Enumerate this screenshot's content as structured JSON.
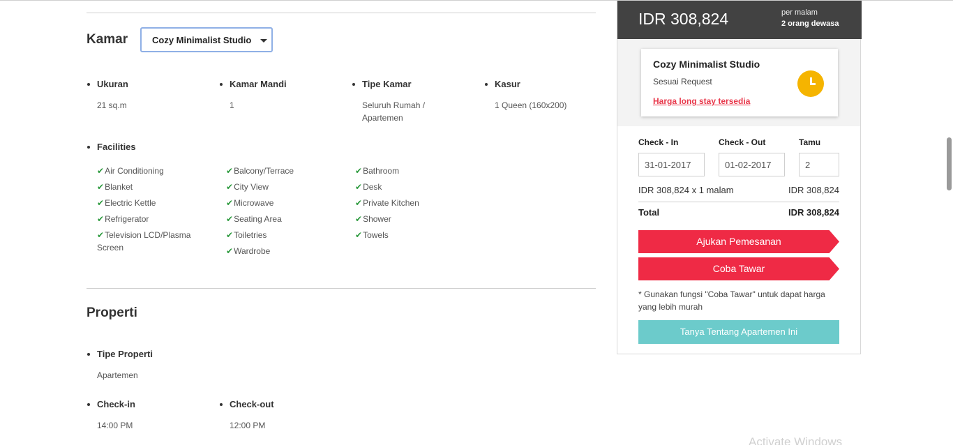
{
  "kamar": {
    "title": "Kamar",
    "selected_room": "Cozy Minimalist Studio",
    "attributes": [
      {
        "label": "Ukuran",
        "value": "21 sq.m"
      },
      {
        "label": "Kamar Mandi",
        "value": "1"
      },
      {
        "label": "Tipe Kamar",
        "value": "Seluruh Rumah / Apartemen"
      },
      {
        "label": "Kasur",
        "value": "1 Queen (160x200)"
      }
    ],
    "facilities_label": "Facilities",
    "facilities": [
      "Air Conditioning",
      "Blanket",
      "Electric Kettle",
      "Refrigerator",
      "Television LCD/Plasma Screen",
      "Balcony/Terrace",
      "City View",
      "Microwave",
      "Seating Area",
      "Toiletries",
      "Wardrobe",
      "Bathroom",
      "Desk",
      "Private Kitchen",
      "Shower",
      "Towels"
    ]
  },
  "properti": {
    "title": "Properti",
    "items": [
      {
        "label": "Tipe Properti",
        "value": "Apartemen"
      },
      {
        "label": "Check-in",
        "value": "14:00 PM"
      },
      {
        "label": "Check-out",
        "value": "12:00 PM"
      }
    ]
  },
  "booking": {
    "price": "IDR 308,824",
    "per_night": "per malam",
    "guests": "2 orang dewasa",
    "room_name": "Cozy Minimalist Studio",
    "request": "Sesuai Request",
    "long_stay_link": "Harga long stay tersedia",
    "checkin_label": "Check - In",
    "checkout_label": "Check - Out",
    "guests_label": "Tamu",
    "checkin_value": "31-01-2017",
    "checkout_value": "01-02-2017",
    "guests_value": "2",
    "line_desc": "IDR 308,824 x 1 malam",
    "line_amount": "IDR 308,824",
    "total_label": "Total",
    "total_amount": "IDR 308,824",
    "submit_label": "Ajukan Pemesanan",
    "offer_label": "Coba Tawar",
    "note": "* Gunakan fungsi \"Coba Tawar\" untuk dapat harga yang lebih murah",
    "ask_label": "Tanya Tentang Apartemen Ini"
  },
  "os": {
    "watermark": "Activate Windows"
  },
  "colors": {
    "accent_red": "#ef2a45",
    "teal": "#6ccbcb",
    "check_green": "#2c9a3d",
    "clock_yellow": "#f5b400",
    "header_dark": "#424242"
  }
}
